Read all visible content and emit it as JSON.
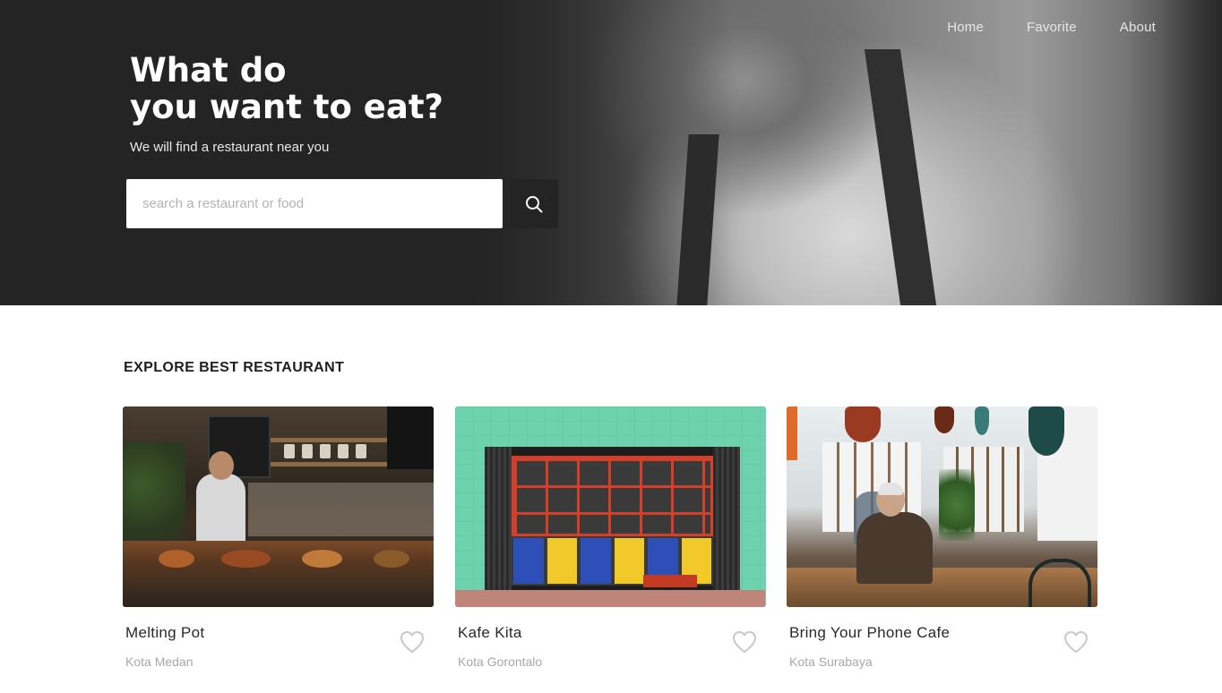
{
  "nav": {
    "items": [
      {
        "label": "Home"
      },
      {
        "label": "Favorite"
      },
      {
        "label": "About"
      }
    ]
  },
  "hero": {
    "title_line1": "What do",
    "title_line2": "you want to eat?",
    "subtitle": "We will find a restaurant near you",
    "search_placeholder": "search a restaurant or food",
    "search_value": "",
    "search_icon": "search-icon"
  },
  "explore": {
    "title": "EXPLORE BEST RESTAURANT",
    "restaurants": [
      {
        "name": "Melting Pot",
        "city": "Kota Medan",
        "favorite_icon": "heart-outline-icon"
      },
      {
        "name": "Kafe Kita",
        "city": "Kota Gorontalo",
        "favorite_icon": "heart-outline-icon"
      },
      {
        "name": "Bring Your Phone Cafe",
        "city": "Kota Surabaya",
        "favorite_icon": "heart-outline-icon"
      }
    ]
  },
  "colors": {
    "hero_bg": "#242424",
    "search_button": "#242424",
    "text_dark": "#2a2a2a",
    "text_muted": "#a8a8a8",
    "heart": "#c8c8c8"
  }
}
